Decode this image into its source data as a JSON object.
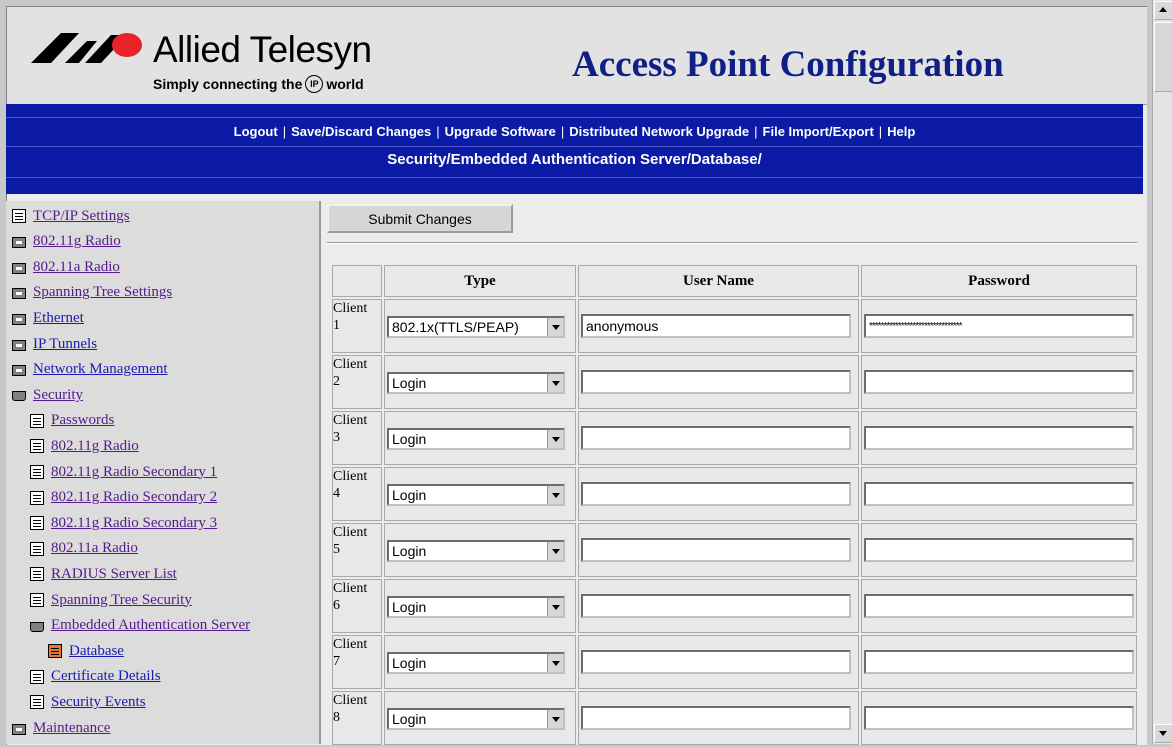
{
  "brand": {
    "name": "Allied Telesyn",
    "tagline_pre": "Simply connecting the",
    "tagline_icon": "IP",
    "tagline_post": "world"
  },
  "page_title": "Access Point Configuration",
  "nav": [
    "Logout",
    "Save/Discard Changes",
    "Upgrade Software",
    "Distributed Network Upgrade",
    "File Import/Export",
    "Help"
  ],
  "breadcrumb": "Security/Embedded Authentication Server/Database/",
  "sidebar": [
    {
      "label": "TCP/IP Settings",
      "icon": "document-icon",
      "indent": 0
    },
    {
      "label": "802.11g Radio",
      "icon": "folder-icon",
      "indent": 0
    },
    {
      "label": "802.11a Radio",
      "icon": "folder-icon",
      "indent": 0
    },
    {
      "label": "Spanning Tree Settings",
      "icon": "folder-icon",
      "indent": 0
    },
    {
      "label": "Ethernet",
      "icon": "folder-icon",
      "indent": 0
    },
    {
      "label": "IP Tunnels",
      "icon": "folder-icon",
      "indent": 0
    },
    {
      "label": "Network Management",
      "icon": "folder-icon",
      "indent": 0
    },
    {
      "label": "Security",
      "icon": "folder-open-icon",
      "indent": 0
    },
    {
      "label": "Passwords",
      "icon": "document-icon",
      "indent": 1
    },
    {
      "label": "802.11g Radio",
      "icon": "document-icon",
      "indent": 1
    },
    {
      "label": "802.11g Radio Secondary 1",
      "icon": "document-icon",
      "indent": 1
    },
    {
      "label": "802.11g Radio Secondary 2",
      "icon": "document-icon",
      "indent": 1
    },
    {
      "label": "802.11g Radio Secondary 3",
      "icon": "document-icon",
      "indent": 1
    },
    {
      "label": "802.11a Radio",
      "icon": "document-icon",
      "indent": 1
    },
    {
      "label": "RADIUS Server List",
      "icon": "document-icon",
      "indent": 1
    },
    {
      "label": "Spanning Tree Security",
      "icon": "document-icon",
      "indent": 1
    },
    {
      "label": "Embedded Authentication Server",
      "icon": "folder-open-icon",
      "indent": 1
    },
    {
      "label": "Database",
      "icon": "document-active-icon",
      "indent": 2
    },
    {
      "label": "Certificate Details",
      "icon": "document-icon",
      "indent": 1
    },
    {
      "label": "Security Events",
      "icon": "document-icon",
      "indent": 1
    },
    {
      "label": "Maintenance",
      "icon": "folder-icon",
      "indent": 0
    }
  ],
  "submit_label": "Submit Changes",
  "table": {
    "headers": [
      "Type",
      "User Name",
      "Password"
    ],
    "rows": [
      {
        "client": "Client",
        "num": "1",
        "type": "802.1x(TTLS/PEAP)",
        "user": "anonymous",
        "password": "********************************"
      },
      {
        "client": "Client",
        "num": "2",
        "type": "Login",
        "user": "",
        "password": ""
      },
      {
        "client": "Client",
        "num": "3",
        "type": "Login",
        "user": "",
        "password": ""
      },
      {
        "client": "Client",
        "num": "4",
        "type": "Login",
        "user": "",
        "password": ""
      },
      {
        "client": "Client",
        "num": "5",
        "type": "Login",
        "user": "",
        "password": ""
      },
      {
        "client": "Client",
        "num": "6",
        "type": "Login",
        "user": "",
        "password": ""
      },
      {
        "client": "Client",
        "num": "7",
        "type": "Login",
        "user": "",
        "password": ""
      },
      {
        "client": "Client",
        "num": "8",
        "type": "Login",
        "user": "",
        "password": ""
      }
    ]
  },
  "colors": {
    "nav_bg": "#0b1ba6",
    "title": "#0f1f86",
    "logo_red": "#e8232a",
    "link_visited": "#551a8b"
  }
}
